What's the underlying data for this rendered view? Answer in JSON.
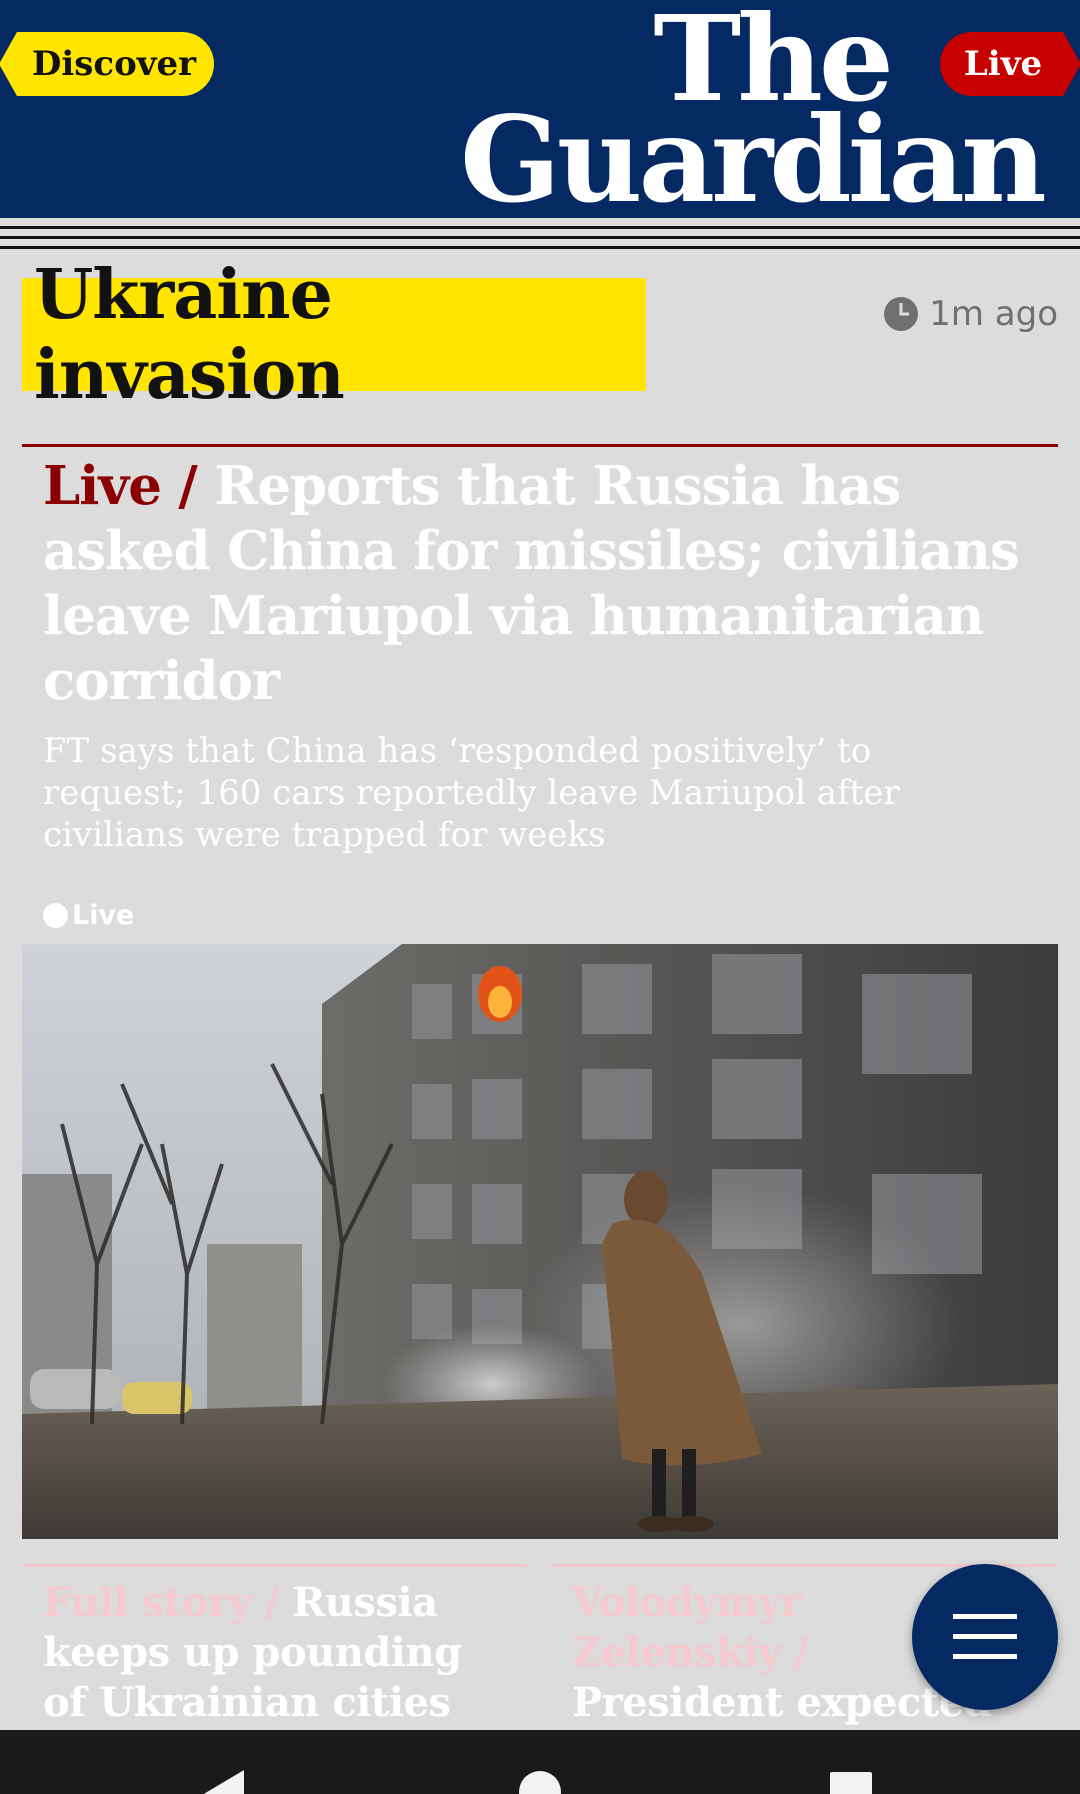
{
  "header": {
    "discover_label": "Discover",
    "live_label": "Live",
    "logo_line1": "The",
    "logo_line2": "Guardian",
    "bg_color": "#052962"
  },
  "article": {
    "kicker": "Ukraine invasion",
    "timestamp": "1m ago",
    "live_prefix": "Live /",
    "headline": "Reports that Russia has asked China for missiles; civilians leave Mariupol via humanitarian corridor",
    "standfirst": "FT says that China has ‘responded positively’ to request; 160 cars reportedly leave Mariupol after civilians were trapped for weeks",
    "live_tag": "Live"
  },
  "cards": [
    {
      "kicker": "Full story /",
      "headline": "Russia keeps up pounding of Ukrainian cities amid"
    },
    {
      "kicker": "Volodymyr Zelenskiy /",
      "headline": "President expected to urge jet transfer in"
    }
  ],
  "colors": {
    "accent_yellow": "#ffe500",
    "live_red": "#c70000",
    "live_kicker": "#8b0000",
    "card_kicker": "#f6cad0"
  },
  "icons": {
    "timestamp": "clock-icon",
    "fab": "menu-icon",
    "nav": [
      "back-icon",
      "home-icon",
      "recents-icon"
    ]
  }
}
